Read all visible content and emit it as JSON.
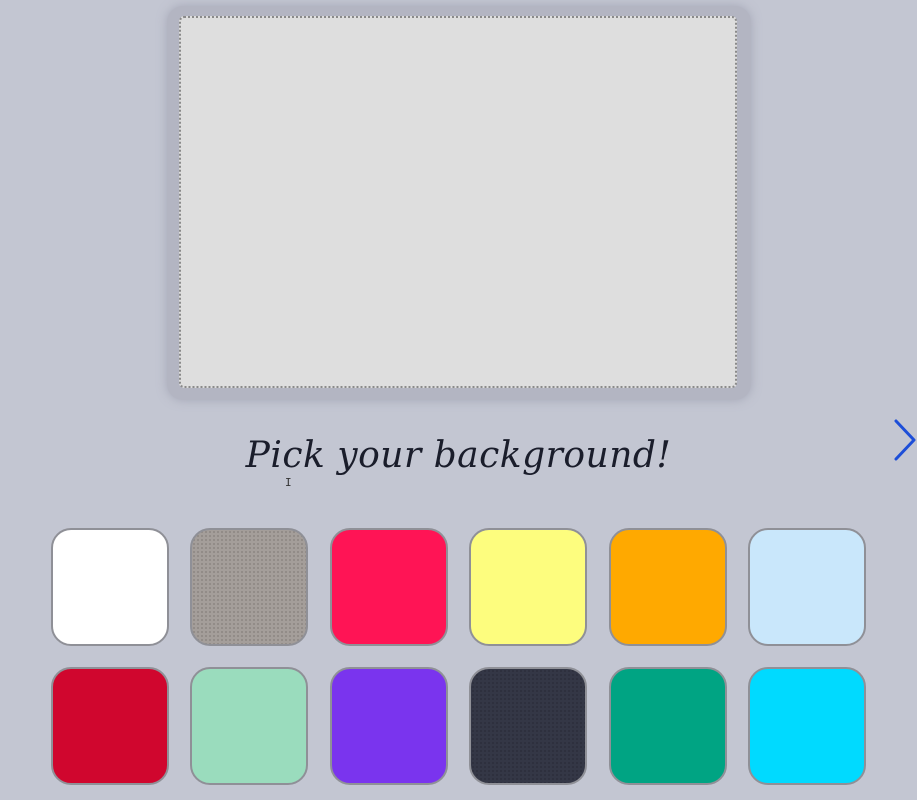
{
  "canvas": {
    "background_color": "#dedede",
    "frame_color": "#b3b5c2"
  },
  "prompt": {
    "text": "Pick your background!"
  },
  "navigation": {
    "next_icon": "chevron-right-icon",
    "next_color": "#1d4ed8"
  },
  "swatches": [
    {
      "name": "white",
      "color": "#ffffff"
    },
    {
      "name": "gray",
      "color": "#a49e9a"
    },
    {
      "name": "pink-red",
      "color": "#ff1455"
    },
    {
      "name": "yellow",
      "color": "#fdfd7e"
    },
    {
      "name": "orange",
      "color": "#ffa900"
    },
    {
      "name": "light-blue",
      "color": "#c9e7fb"
    },
    {
      "name": "crimson",
      "color": "#d0062e"
    },
    {
      "name": "mint",
      "color": "#9adcbd"
    },
    {
      "name": "purple",
      "color": "#7a34ee"
    },
    {
      "name": "charcoal",
      "color": "#343746"
    },
    {
      "name": "teal",
      "color": "#00a483"
    },
    {
      "name": "cyan",
      "color": "#00daff"
    }
  ]
}
